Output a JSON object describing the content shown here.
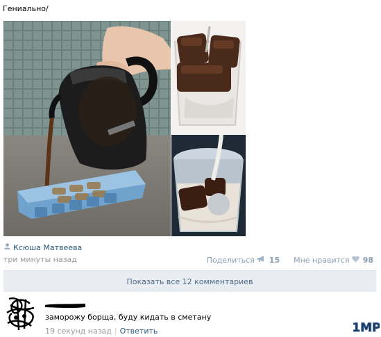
{
  "post": {
    "text": "Гениально/",
    "author": "Ксюша Матвеева",
    "time": "три минуты назад"
  },
  "actions": {
    "share_label": "Поделиться",
    "share_count": "15",
    "like_label": "Мне нравится",
    "like_count": "98"
  },
  "comments": {
    "show_all_label": "Показать все 12 комментариев"
  },
  "comment": {
    "text": "заморожу борща, буду кидать в сметану",
    "time": "19 секунд назад",
    "reply_label": "Ответить"
  },
  "watermark": {
    "text": "1MP"
  },
  "colors": {
    "link": "#2b587a",
    "muted": "#999999",
    "bar_bg": "#e9edf1"
  }
}
